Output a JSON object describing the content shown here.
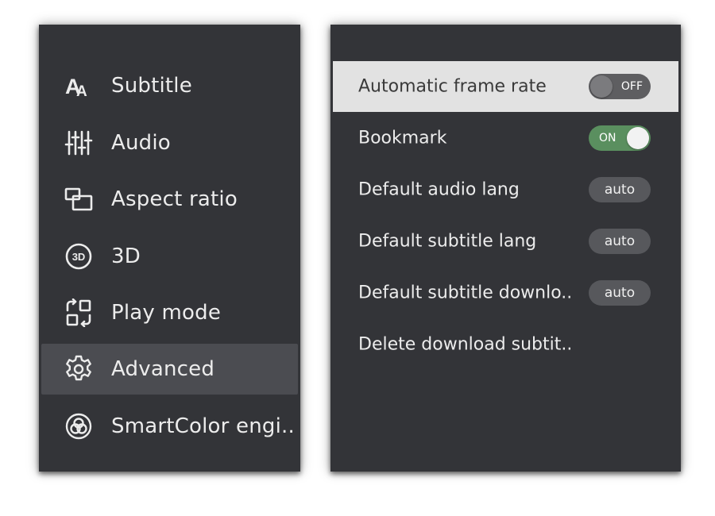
{
  "left_menu": {
    "items": [
      {
        "label": "Subtitle",
        "icon": "subtitle-icon"
      },
      {
        "label": "Audio",
        "icon": "equalizer-icon"
      },
      {
        "label": "Aspect ratio",
        "icon": "aspect-ratio-icon"
      },
      {
        "label": "3D",
        "icon": "3d-icon"
      },
      {
        "label": "Play mode",
        "icon": "play-mode-icon"
      },
      {
        "label": "Advanced",
        "icon": "gear-icon",
        "active": true
      },
      {
        "label": "SmartColor engi..",
        "icon": "smartcolor-icon"
      }
    ]
  },
  "settings": {
    "rows": [
      {
        "label": "Automatic frame rate",
        "control": "toggle",
        "state": "OFF",
        "active": true
      },
      {
        "label": "Bookmark",
        "control": "toggle",
        "state": "ON"
      },
      {
        "label": "Default audio lang",
        "control": "pill",
        "value": "auto"
      },
      {
        "label": "Default subtitle lang",
        "control": "pill",
        "value": "auto"
      },
      {
        "label": "Default subtitle downlo..",
        "control": "pill",
        "value": "auto"
      },
      {
        "label": "Delete download subtit..",
        "control": "none"
      }
    ]
  },
  "colors": {
    "panel_bg": "#333438",
    "active_menu_bg": "#4b4c51",
    "active_row_bg": "#e2e2e2",
    "toggle_on": "#5a8f5f",
    "toggle_off": "#5e5e61"
  }
}
